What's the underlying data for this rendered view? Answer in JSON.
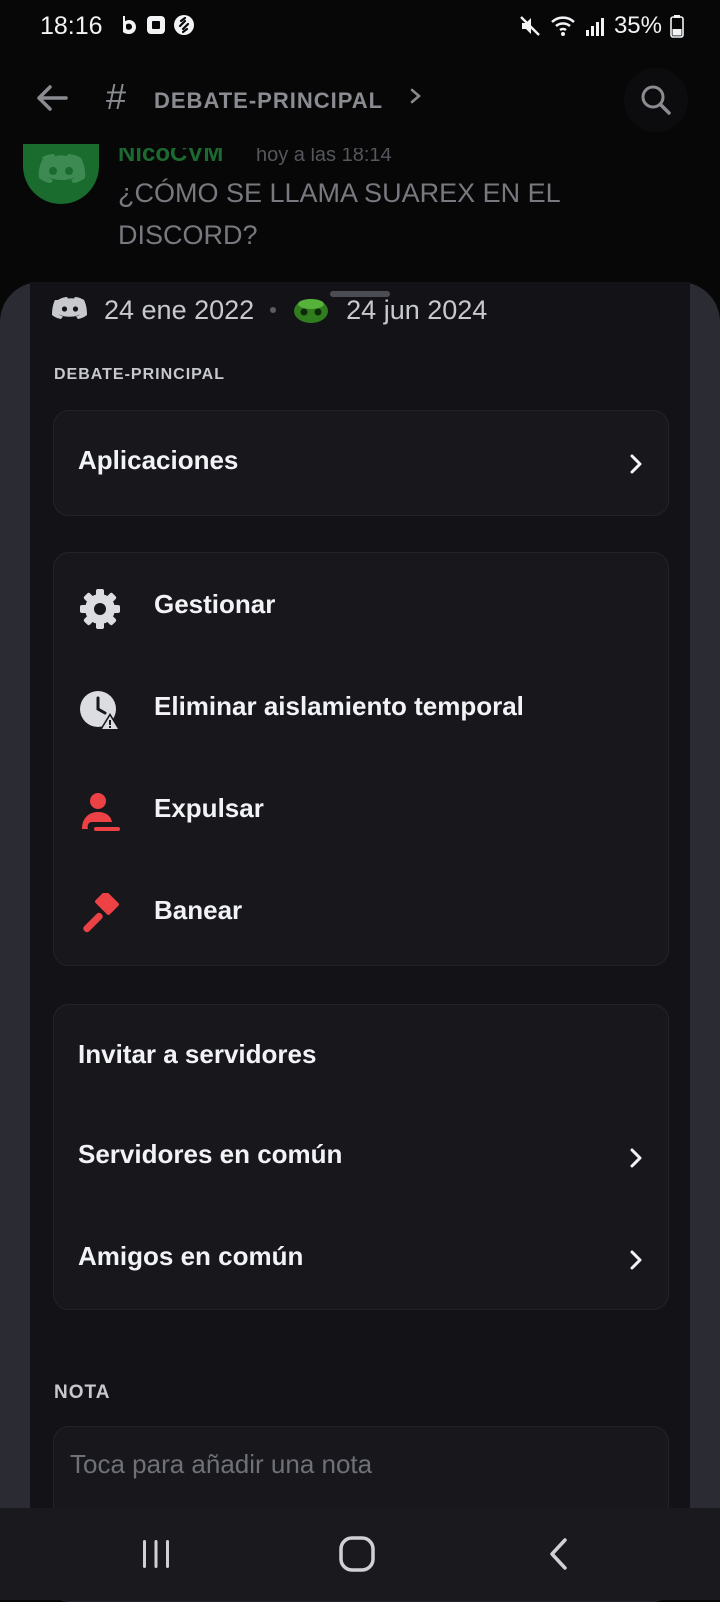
{
  "status_bar": {
    "time": "18:16",
    "battery": "35%",
    "left_icons": [
      "b-app-icon",
      "square-app-icon",
      "shazam-icon"
    ],
    "right_icons": [
      "mute-icon",
      "wifi-icon",
      "signal-icon",
      "battery-icon"
    ]
  },
  "header": {
    "channel_name": "DEBATE-PRINCIPAL",
    "icons": [
      "back-arrow-icon",
      "hash-icon",
      "chevron-right-icon",
      "search-icon"
    ]
  },
  "message": {
    "author": "NicoCVM",
    "timestamp": "hoy a las 18:14",
    "text": "¿CÓMO SE LLAMA SUAREX EN EL DISCORD?"
  },
  "profile": {
    "discord_member_since": "24 ene 2022",
    "server_member_since": "24 jun 2024"
  },
  "section_label": "DEBATE-PRINCIPAL",
  "apps_card": {
    "label": "Aplicaciones"
  },
  "moderation": {
    "items": [
      {
        "label": "Gestionar",
        "icon": "gear-icon"
      },
      {
        "label": "Eliminar aislamiento temporal",
        "icon": "clock-warning-icon"
      },
      {
        "label": "Expulsar",
        "icon": "kick-user-icon"
      },
      {
        "label": "Banear",
        "icon": "ban-hammer-icon"
      }
    ]
  },
  "social": {
    "items": [
      {
        "label": "Invitar a servidores"
      },
      {
        "label": "Servidores en común"
      },
      {
        "label": "Amigos en común"
      }
    ]
  },
  "note": {
    "title": "NOTA",
    "placeholder": "Toca para añadir una nota"
  },
  "colors": {
    "danger": "#ed4245",
    "sheet_bg": "#131317",
    "card_bg": "#17171c",
    "text_primary": "#f2f3f5"
  }
}
